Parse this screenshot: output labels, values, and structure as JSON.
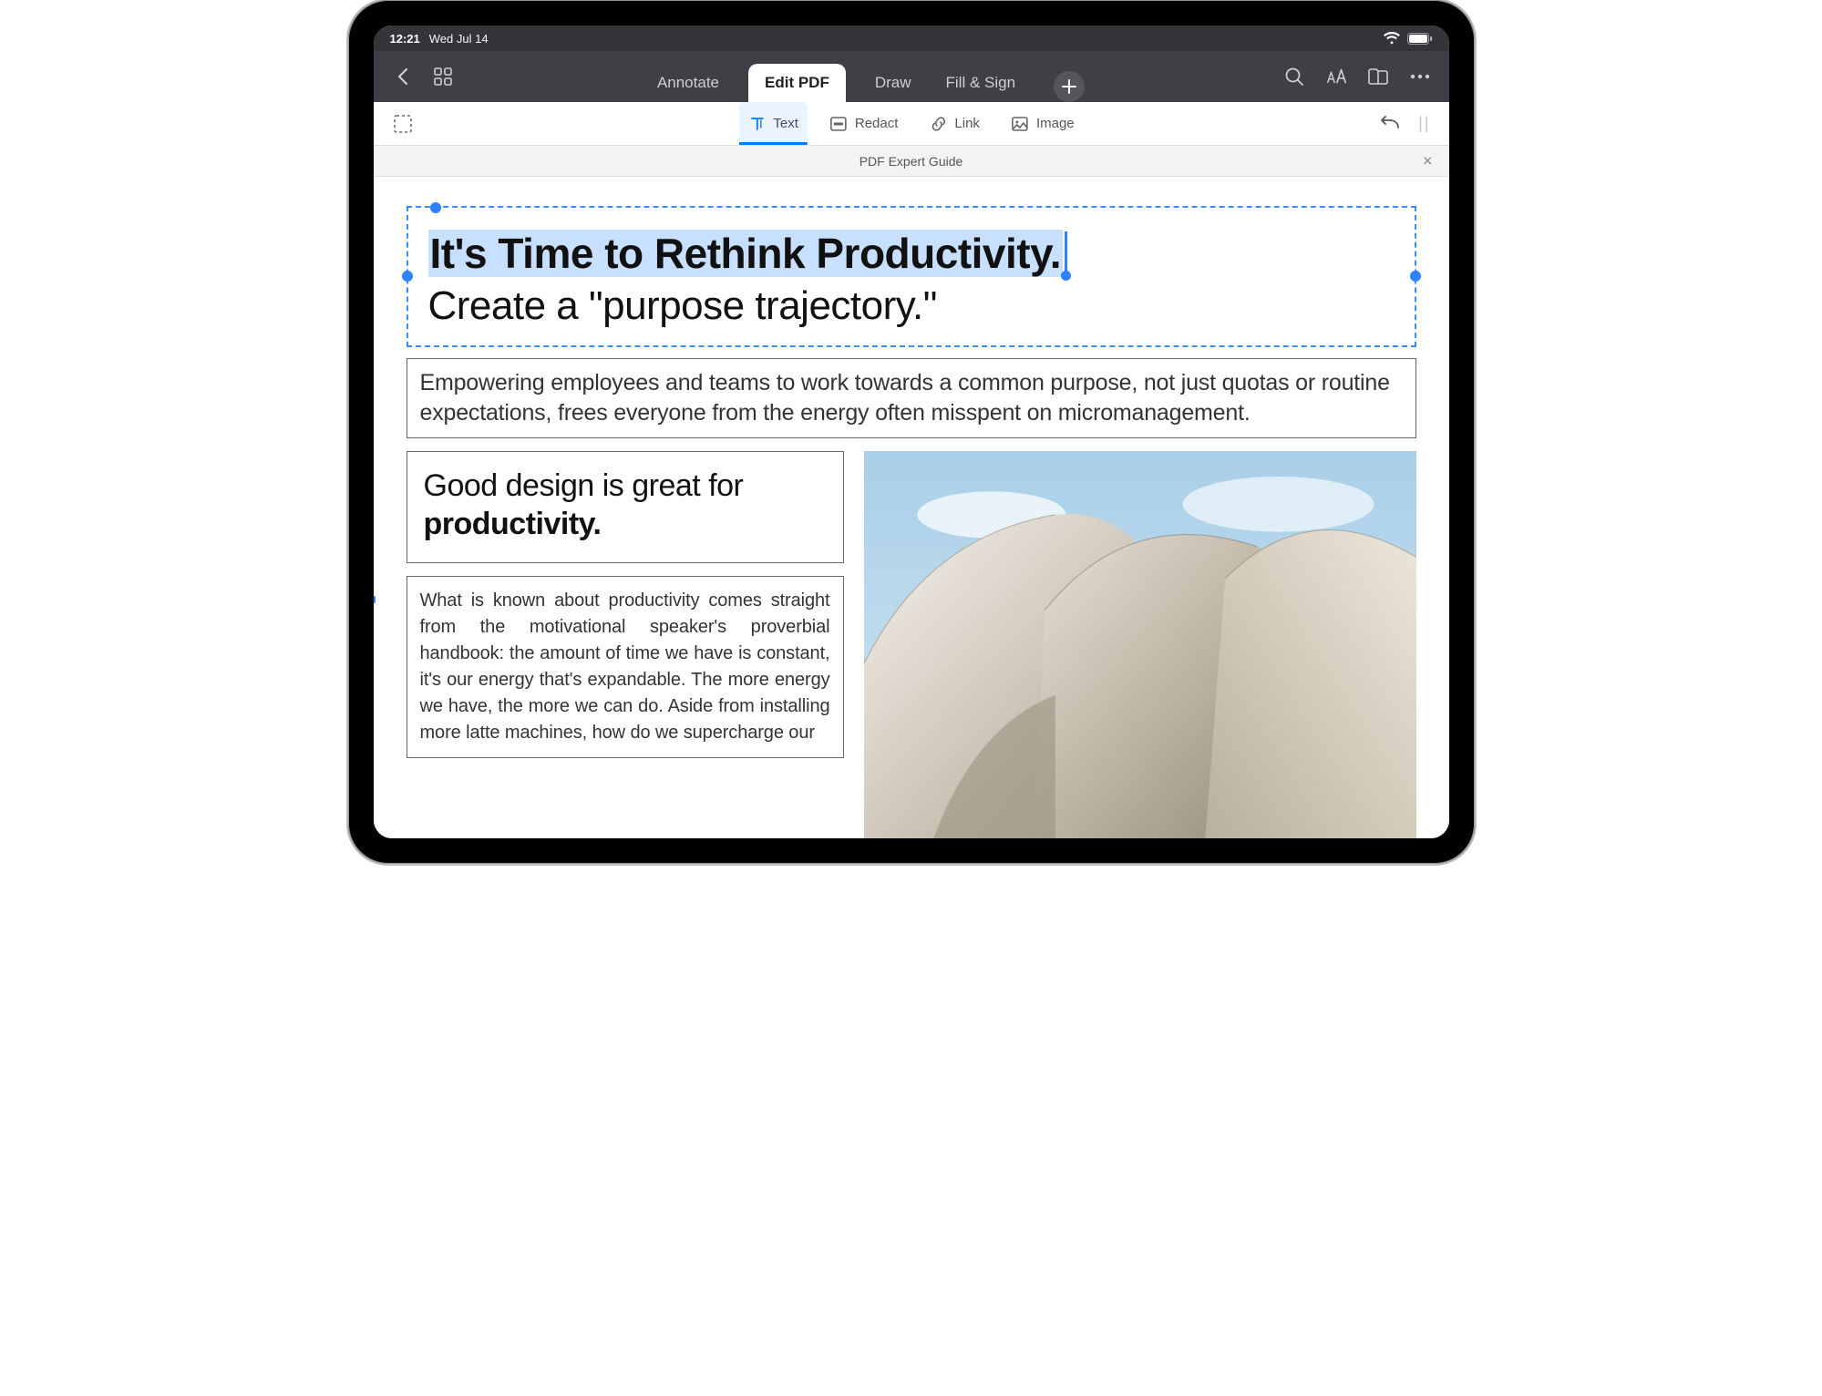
{
  "status": {
    "time": "12:21",
    "date": "Wed Jul 14"
  },
  "main_tabs": {
    "annotate": "Annotate",
    "edit_pdf": "Edit PDF",
    "draw": "Draw",
    "fill_sign": "Fill & Sign"
  },
  "tools": {
    "text": "Text",
    "redact": "Redact",
    "link": "Link",
    "image": "Image"
  },
  "file_tab": {
    "title": "PDF Expert Guide"
  },
  "document": {
    "headline_bold": "It's Time to Rethink Productivity.",
    "headline_sub": "Create a \"purpose trajectory.\"",
    "intro_para": "Empowering employees and teams to work towards a common purpose, not just quotas or routine expectations, frees everyone from the energy often misspent on micromanagement.",
    "sub_head_pre": "Good design is great for ",
    "sub_head_bold": "productivity.",
    "body": "What is known about productivity comes straight from the motivational speaker's proverbial handbook: the amount of time we have is constant, it's our energy that's expandable. The more energy we have, the more we can do. Aside from installing more latte machines, how do we supercharge our"
  }
}
